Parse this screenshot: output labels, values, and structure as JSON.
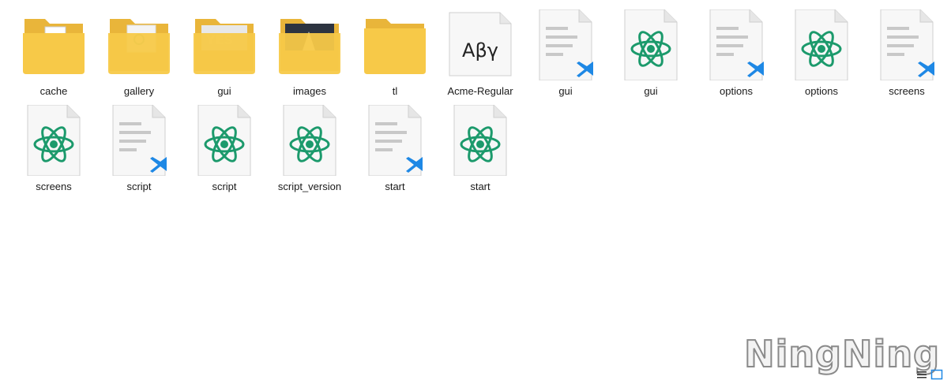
{
  "items": [
    {
      "label": "cache",
      "kind": "folder",
      "preview": "doc"
    },
    {
      "label": "gallery",
      "kind": "folder",
      "preview": "image"
    },
    {
      "label": "gui",
      "kind": "folder",
      "preview": "text"
    },
    {
      "label": "images",
      "kind": "folder",
      "preview": "photo"
    },
    {
      "label": "tl",
      "kind": "folder",
      "preview": "empty"
    },
    {
      "label": "Acme-Regular",
      "kind": "font",
      "sample": "Aβγ"
    },
    {
      "label": "gui",
      "kind": "vscode-file"
    },
    {
      "label": "gui",
      "kind": "atom-file"
    },
    {
      "label": "options",
      "kind": "vscode-file"
    },
    {
      "label": "options",
      "kind": "atom-file"
    },
    {
      "label": "screens",
      "kind": "vscode-file"
    },
    {
      "label": "screens",
      "kind": "atom-file"
    },
    {
      "label": "script",
      "kind": "vscode-file"
    },
    {
      "label": "script",
      "kind": "atom-file"
    },
    {
      "label": "script_version",
      "kind": "atom-file"
    },
    {
      "label": "start",
      "kind": "vscode-file"
    },
    {
      "label": "start",
      "kind": "atom-file"
    }
  ],
  "watermark": "NingNing",
  "colors": {
    "folder": "#F7C948",
    "folder_back": "#E9B53A",
    "atom": "#1C9A6C",
    "vscode": "#1E88E5"
  }
}
